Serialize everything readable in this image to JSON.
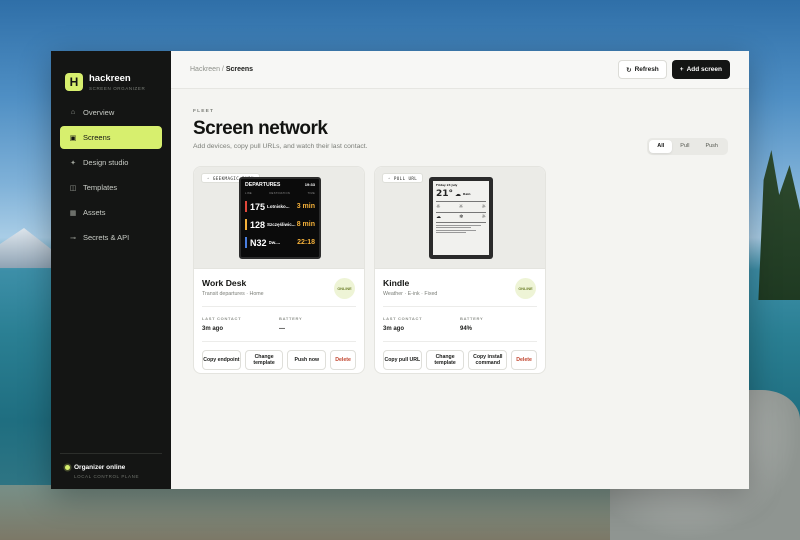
{
  "app": {
    "name": "hackreen",
    "subtitle": "SCREEN ORGANIZER",
    "logo_letter": "H",
    "accent": "#d7ef6e"
  },
  "sidebar": {
    "items": [
      {
        "label": "Overview",
        "icon": "home-icon",
        "glyph": "⌂"
      },
      {
        "label": "Screens",
        "icon": "screen-icon",
        "glyph": "▣"
      },
      {
        "label": "Design studio",
        "icon": "sparkle-icon",
        "glyph": "✦"
      },
      {
        "label": "Templates",
        "icon": "template-icon",
        "glyph": "◫"
      },
      {
        "label": "Assets",
        "icon": "image-icon",
        "glyph": "▦"
      },
      {
        "label": "Secrets & API",
        "icon": "key-icon",
        "glyph": "⊸"
      }
    ],
    "footer": {
      "status": "Organizer online",
      "sub": "LOCAL CONTROL PLANE"
    }
  },
  "topbar": {
    "breadcrumb_root": "Hackreen",
    "breadcrumb_sep": " / ",
    "breadcrumb_current": "Screens",
    "refresh_icon": "↻",
    "refresh_label": "Refresh",
    "add_icon": "+",
    "add_label": "Add screen"
  },
  "page": {
    "eyebrow": "FLEET",
    "title": "Screen network",
    "subtitle": "Add devices, copy pull URLs, and watch their last contact.",
    "filters": [
      "All",
      "Pull",
      "Push"
    ]
  },
  "cards": [
    {
      "tag": "◦ GEEKMAGIC PUSH",
      "name": "Work Desk",
      "desc": "Transit departures · Home",
      "status": "ONLINE",
      "last_contact_label": "LAST CONTACT",
      "last_contact": "3m ago",
      "battery_label": "BATTERY",
      "battery": "—",
      "actions": [
        "Copy endpoint",
        "Change template",
        "Push now",
        "Delete"
      ],
      "screen": {
        "title": "DEPARTURES",
        "time": "19:33",
        "cols": [
          "LINE",
          "DESTINATION",
          "TIME"
        ],
        "rows": [
          {
            "line": "175",
            "dest": "Lotnisko...",
            "time": "3 min",
            "color": "#e0473a"
          },
          {
            "line": "128",
            "dest": "Szczęśliwic...",
            "time": "8 min",
            "color": "#f5b13a"
          },
          {
            "line": "N32",
            "dest": "Dw....",
            "time": "22:18",
            "color": "#4a7fe0"
          }
        ]
      }
    },
    {
      "tag": "◦ PULL URL",
      "name": "Kindle",
      "desc": "Weather · E-ink · Fixed",
      "status": "ONLINE",
      "last_contact_label": "LAST CONTACT",
      "last_contact": "3m ago",
      "battery_label": "BATTERY",
      "battery": "94%",
      "actions": [
        "Copy pull URL",
        "Change template",
        "Copy install command",
        "Delete"
      ],
      "screen": {
        "date": "Friday 24 July",
        "temp": "21°",
        "cond": "Rain"
      }
    }
  ]
}
